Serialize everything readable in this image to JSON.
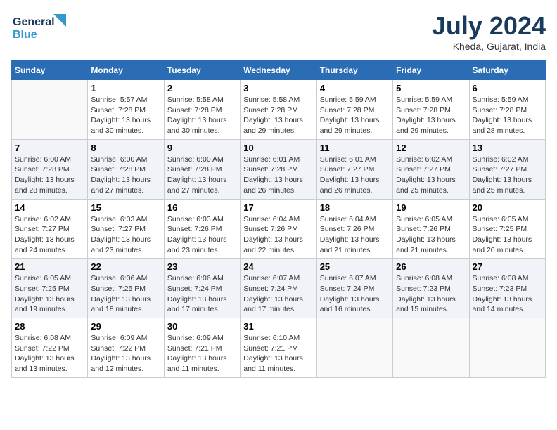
{
  "header": {
    "logo_line1": "General",
    "logo_line2": "Blue",
    "month_title": "July 2024",
    "location": "Kheda, Gujarat, India"
  },
  "days_of_week": [
    "Sunday",
    "Monday",
    "Tuesday",
    "Wednesday",
    "Thursday",
    "Friday",
    "Saturday"
  ],
  "weeks": [
    [
      {
        "day": "",
        "empty": true
      },
      {
        "day": "1",
        "sunrise": "Sunrise: 5:57 AM",
        "sunset": "Sunset: 7:28 PM",
        "daylight": "Daylight: 13 hours and 30 minutes."
      },
      {
        "day": "2",
        "sunrise": "Sunrise: 5:58 AM",
        "sunset": "Sunset: 7:28 PM",
        "daylight": "Daylight: 13 hours and 30 minutes."
      },
      {
        "day": "3",
        "sunrise": "Sunrise: 5:58 AM",
        "sunset": "Sunset: 7:28 PM",
        "daylight": "Daylight: 13 hours and 29 minutes."
      },
      {
        "day": "4",
        "sunrise": "Sunrise: 5:59 AM",
        "sunset": "Sunset: 7:28 PM",
        "daylight": "Daylight: 13 hours and 29 minutes."
      },
      {
        "day": "5",
        "sunrise": "Sunrise: 5:59 AM",
        "sunset": "Sunset: 7:28 PM",
        "daylight": "Daylight: 13 hours and 29 minutes."
      },
      {
        "day": "6",
        "sunrise": "Sunrise: 5:59 AM",
        "sunset": "Sunset: 7:28 PM",
        "daylight": "Daylight: 13 hours and 28 minutes."
      }
    ],
    [
      {
        "day": "7",
        "sunrise": "Sunrise: 6:00 AM",
        "sunset": "Sunset: 7:28 PM",
        "daylight": "Daylight: 13 hours and 28 minutes."
      },
      {
        "day": "8",
        "sunrise": "Sunrise: 6:00 AM",
        "sunset": "Sunset: 7:28 PM",
        "daylight": "Daylight: 13 hours and 27 minutes."
      },
      {
        "day": "9",
        "sunrise": "Sunrise: 6:00 AM",
        "sunset": "Sunset: 7:28 PM",
        "daylight": "Daylight: 13 hours and 27 minutes."
      },
      {
        "day": "10",
        "sunrise": "Sunrise: 6:01 AM",
        "sunset": "Sunset: 7:28 PM",
        "daylight": "Daylight: 13 hours and 26 minutes."
      },
      {
        "day": "11",
        "sunrise": "Sunrise: 6:01 AM",
        "sunset": "Sunset: 7:27 PM",
        "daylight": "Daylight: 13 hours and 26 minutes."
      },
      {
        "day": "12",
        "sunrise": "Sunrise: 6:02 AM",
        "sunset": "Sunset: 7:27 PM",
        "daylight": "Daylight: 13 hours and 25 minutes."
      },
      {
        "day": "13",
        "sunrise": "Sunrise: 6:02 AM",
        "sunset": "Sunset: 7:27 PM",
        "daylight": "Daylight: 13 hours and 25 minutes."
      }
    ],
    [
      {
        "day": "14",
        "sunrise": "Sunrise: 6:02 AM",
        "sunset": "Sunset: 7:27 PM",
        "daylight": "Daylight: 13 hours and 24 minutes."
      },
      {
        "day": "15",
        "sunrise": "Sunrise: 6:03 AM",
        "sunset": "Sunset: 7:27 PM",
        "daylight": "Daylight: 13 hours and 23 minutes."
      },
      {
        "day": "16",
        "sunrise": "Sunrise: 6:03 AM",
        "sunset": "Sunset: 7:26 PM",
        "daylight": "Daylight: 13 hours and 23 minutes."
      },
      {
        "day": "17",
        "sunrise": "Sunrise: 6:04 AM",
        "sunset": "Sunset: 7:26 PM",
        "daylight": "Daylight: 13 hours and 22 minutes."
      },
      {
        "day": "18",
        "sunrise": "Sunrise: 6:04 AM",
        "sunset": "Sunset: 7:26 PM",
        "daylight": "Daylight: 13 hours and 21 minutes."
      },
      {
        "day": "19",
        "sunrise": "Sunrise: 6:05 AM",
        "sunset": "Sunset: 7:26 PM",
        "daylight": "Daylight: 13 hours and 21 minutes."
      },
      {
        "day": "20",
        "sunrise": "Sunrise: 6:05 AM",
        "sunset": "Sunset: 7:25 PM",
        "daylight": "Daylight: 13 hours and 20 minutes."
      }
    ],
    [
      {
        "day": "21",
        "sunrise": "Sunrise: 6:05 AM",
        "sunset": "Sunset: 7:25 PM",
        "daylight": "Daylight: 13 hours and 19 minutes."
      },
      {
        "day": "22",
        "sunrise": "Sunrise: 6:06 AM",
        "sunset": "Sunset: 7:25 PM",
        "daylight": "Daylight: 13 hours and 18 minutes."
      },
      {
        "day": "23",
        "sunrise": "Sunrise: 6:06 AM",
        "sunset": "Sunset: 7:24 PM",
        "daylight": "Daylight: 13 hours and 17 minutes."
      },
      {
        "day": "24",
        "sunrise": "Sunrise: 6:07 AM",
        "sunset": "Sunset: 7:24 PM",
        "daylight": "Daylight: 13 hours and 17 minutes."
      },
      {
        "day": "25",
        "sunrise": "Sunrise: 6:07 AM",
        "sunset": "Sunset: 7:24 PM",
        "daylight": "Daylight: 13 hours and 16 minutes."
      },
      {
        "day": "26",
        "sunrise": "Sunrise: 6:08 AM",
        "sunset": "Sunset: 7:23 PM",
        "daylight": "Daylight: 13 hours and 15 minutes."
      },
      {
        "day": "27",
        "sunrise": "Sunrise: 6:08 AM",
        "sunset": "Sunset: 7:23 PM",
        "daylight": "Daylight: 13 hours and 14 minutes."
      }
    ],
    [
      {
        "day": "28",
        "sunrise": "Sunrise: 6:08 AM",
        "sunset": "Sunset: 7:22 PM",
        "daylight": "Daylight: 13 hours and 13 minutes."
      },
      {
        "day": "29",
        "sunrise": "Sunrise: 6:09 AM",
        "sunset": "Sunset: 7:22 PM",
        "daylight": "Daylight: 13 hours and 12 minutes."
      },
      {
        "day": "30",
        "sunrise": "Sunrise: 6:09 AM",
        "sunset": "Sunset: 7:21 PM",
        "daylight": "Daylight: 13 hours and 11 minutes."
      },
      {
        "day": "31",
        "sunrise": "Sunrise: 6:10 AM",
        "sunset": "Sunset: 7:21 PM",
        "daylight": "Daylight: 13 hours and 11 minutes."
      },
      {
        "day": "",
        "empty": true
      },
      {
        "day": "",
        "empty": true
      },
      {
        "day": "",
        "empty": true
      }
    ]
  ]
}
